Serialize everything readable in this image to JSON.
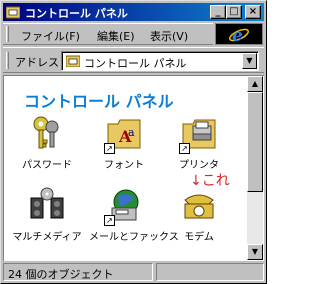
{
  "window": {
    "title": "コントロール パネル",
    "controls": {
      "minimize": "_",
      "maximize": "□",
      "close": "×"
    }
  },
  "menu": {
    "items": [
      {
        "label": "ファイル(F)"
      },
      {
        "label": "編集(E)"
      },
      {
        "label": "表示(V)"
      }
    ]
  },
  "address": {
    "label": "アドレス",
    "value": "コントロール パネル"
  },
  "content": {
    "heading": "コントロール パネル",
    "items": [
      {
        "label": "パスワード",
        "icon": "keys-icon"
      },
      {
        "label": "フォント",
        "icon": "fonts-folder-icon"
      },
      {
        "label": "プリンタ",
        "icon": "printers-folder-icon"
      },
      {
        "label": "マルチメディア",
        "icon": "multimedia-icon"
      },
      {
        "label": "メールとファックス",
        "icon": "mail-fax-icon"
      },
      {
        "label": "モデム",
        "icon": "modem-telephone-icon"
      }
    ],
    "annotation": "↓これ"
  },
  "status": {
    "text": "24 個のオブジェクト"
  },
  "colors": {
    "titlebar_start": "#000080",
    "titlebar_end": "#1084d0",
    "heading": "#0a7fd8",
    "annotation": "#e02020"
  }
}
